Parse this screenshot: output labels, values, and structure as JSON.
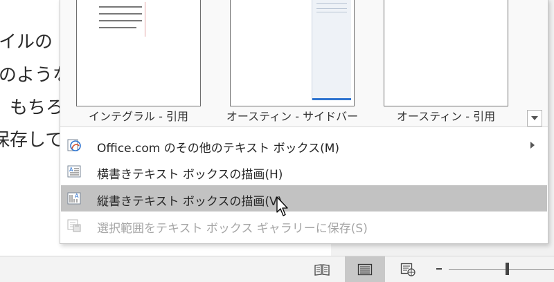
{
  "document": {
    "lines": [
      "イルの",
      "のような",
      "もちろ",
      "保存して"
    ]
  },
  "gallery": {
    "thumbnails": [
      {
        "label": "インテグラル - 引用",
        "icon": "integral-quote-thumbnail"
      },
      {
        "label": "オースティン - サイドバー",
        "icon": "austin-sidebar-thumbnail"
      },
      {
        "label": "オースティン - 引用",
        "icon": "austin-quote-thumbnail"
      }
    ],
    "scroll_icon": "chevron-down-icon",
    "menu_items": [
      {
        "label": "Office.com のその他のテキスト ボックス(M)",
        "icon": "office-com-icon",
        "has_submenu": true,
        "state": "normal"
      },
      {
        "label": "横書きテキスト ボックスの描画(H)",
        "icon": "horizontal-textbox-icon",
        "has_submenu": false,
        "state": "normal"
      },
      {
        "label": "縦書きテキスト ボックスの描画(V)",
        "icon": "vertical-textbox-icon",
        "has_submenu": false,
        "state": "hover"
      },
      {
        "label": "選択範囲をテキスト ボックス ギャラリーに保存(S)",
        "icon": "save-to-gallery-icon",
        "has_submenu": false,
        "state": "disabled"
      }
    ]
  },
  "statusbar": {
    "views": [
      {
        "name": "read-mode-icon",
        "active": false
      },
      {
        "name": "print-layout-icon",
        "active": true
      },
      {
        "name": "web-layout-icon",
        "active": false
      }
    ],
    "zoom_out_label": "-"
  },
  "colors": {
    "hover_bg": "#c2c2c2",
    "disabled_text": "#a6a6a6",
    "accent_blue": "#2e74d0"
  }
}
